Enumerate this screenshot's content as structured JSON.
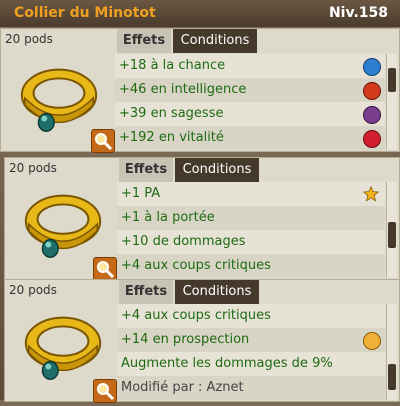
{
  "item": {
    "name": "Collier du Minotot",
    "level": "Niv.158"
  },
  "tabs": {
    "effects": "Effets",
    "conditions": "Conditions"
  },
  "panels": [
    {
      "pods": "20 pods",
      "rows": [
        {
          "text": "+18 à la chance",
          "icon": "water-icon"
        },
        {
          "text": "+46 en intelligence",
          "icon": "fire-icon"
        },
        {
          "text": "+39 en sagesse",
          "icon": "wisdom-icon"
        },
        {
          "text": "+192 en vitalité",
          "icon": "heart-icon"
        }
      ]
    },
    {
      "pods": "20 pods",
      "rows": [
        {
          "text": "+1 PA",
          "icon": "star-icon"
        },
        {
          "text": "+1 à la portée",
          "icon": ""
        },
        {
          "text": "+10 de dommages",
          "icon": ""
        },
        {
          "text": "+4 aux coups critiques",
          "icon": ""
        }
      ]
    },
    {
      "pods": "20 pods",
      "rows": [
        {
          "text": "+4 aux coups critiques",
          "icon": ""
        },
        {
          "text": "+14 en prospection",
          "icon": "prospecting-icon"
        },
        {
          "text": "Augmente les dommages de 9%",
          "icon": ""
        },
        {
          "text": "Modifié par : Aznet",
          "icon": ""
        }
      ]
    }
  ],
  "colors": {
    "effect_text": "#1f6a12",
    "title_name": "#f0a020"
  }
}
